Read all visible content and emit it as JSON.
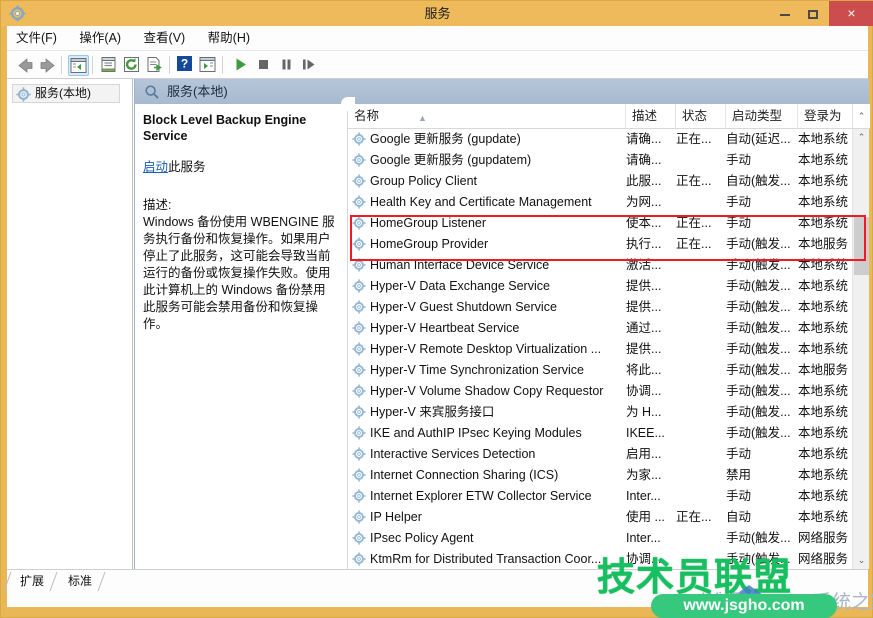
{
  "window": {
    "title": "服务",
    "app_icon": "services-gear-icon",
    "minimize_label": "最小化",
    "maximize_label": "最大化",
    "close_label": "×"
  },
  "menu": {
    "items": [
      {
        "label": "文件(F)",
        "name": "menu-file"
      },
      {
        "label": "操作(A)",
        "name": "menu-action"
      },
      {
        "label": "查看(V)",
        "name": "menu-view"
      },
      {
        "label": "帮助(H)",
        "name": "menu-help"
      }
    ]
  },
  "toolbar": {
    "buttons": [
      {
        "name": "back-icon",
        "glyph": "left-arrow"
      },
      {
        "name": "forward-icon",
        "glyph": "right-arrow"
      },
      {
        "name": "show-hide-console-tree-icon",
        "glyph": "console-tree",
        "selected": true
      },
      {
        "name": "properties-icon",
        "glyph": "properties"
      },
      {
        "name": "refresh-icon",
        "glyph": "refresh"
      },
      {
        "name": "export-list-icon",
        "glyph": "export"
      },
      {
        "name": "help-icon",
        "glyph": "help"
      },
      {
        "name": "show-action-pane-icon",
        "glyph": "action-pane"
      },
      {
        "name": "start-service-icon",
        "glyph": "play"
      },
      {
        "name": "stop-service-icon",
        "glyph": "stop"
      },
      {
        "name": "pause-service-icon",
        "glyph": "pause"
      },
      {
        "name": "restart-service-icon",
        "glyph": "restart"
      }
    ]
  },
  "tree": {
    "root_label": "服务(本地)",
    "root_icon": "services-gear-icon"
  },
  "right_pane": {
    "header_label": "服务(本地)",
    "header_icon": "services-magnifier-icon"
  },
  "details": {
    "service_name": "Block Level Backup Engine Service",
    "action_link": "启动",
    "action_suffix": "此服务",
    "description_label": "描述:",
    "description_body": "Windows 备份使用 WBENGINE 服务执行备份和恢复操作。如果用户停止了此服务，这可能会导致当前运行的备份或恢复操作失败。使用此计算机上的 Windows 备份禁用此服务可能会禁用备份和恢复操作。"
  },
  "list": {
    "columns": [
      {
        "key": "name",
        "label": "名称",
        "sorted": "asc"
      },
      {
        "key": "desc",
        "label": "描述"
      },
      {
        "key": "status",
        "label": "状态"
      },
      {
        "key": "startup",
        "label": "启动类型"
      },
      {
        "key": "logon",
        "label": "登录为"
      }
    ],
    "row_icon": "service-gear-icon",
    "rows": [
      {
        "name": "Google 更新服务 (gupdate)",
        "desc": "请确...",
        "status": "正在...",
        "startup": "自动(延迟...",
        "logon": "本地系统"
      },
      {
        "name": "Google 更新服务 (gupdatem)",
        "desc": "请确...",
        "status": "",
        "startup": "手动",
        "logon": "本地系统"
      },
      {
        "name": "Group Policy Client",
        "desc": "此服...",
        "status": "正在...",
        "startup": "自动(触发...",
        "logon": "本地系统"
      },
      {
        "name": "Health Key and Certificate Management",
        "desc": "为网...",
        "status": "",
        "startup": "手动",
        "logon": "本地系统"
      },
      {
        "name": "HomeGroup Listener",
        "desc": "使本...",
        "status": "正在...",
        "startup": "手动",
        "logon": "本地系统",
        "highlighted": true
      },
      {
        "name": "HomeGroup Provider",
        "desc": "执行...",
        "status": "正在...",
        "startup": "手动(触发...",
        "logon": "本地服务",
        "highlighted": true
      },
      {
        "name": "Human Interface Device Service",
        "desc": "激活...",
        "status": "",
        "startup": "手动(触发...",
        "logon": "本地系统"
      },
      {
        "name": "Hyper-V Data Exchange Service",
        "desc": "提供...",
        "status": "",
        "startup": "手动(触发...",
        "logon": "本地系统"
      },
      {
        "name": "Hyper-V Guest Shutdown Service",
        "desc": "提供...",
        "status": "",
        "startup": "手动(触发...",
        "logon": "本地系统"
      },
      {
        "name": "Hyper-V Heartbeat Service",
        "desc": "通过...",
        "status": "",
        "startup": "手动(触发...",
        "logon": "本地系统"
      },
      {
        "name": "Hyper-V Remote Desktop Virtualization ...",
        "desc": "提供...",
        "status": "",
        "startup": "手动(触发...",
        "logon": "本地系统"
      },
      {
        "name": "Hyper-V Time Synchronization Service",
        "desc": "将此...",
        "status": "",
        "startup": "手动(触发...",
        "logon": "本地服务"
      },
      {
        "name": "Hyper-V Volume Shadow Copy Requestor",
        "desc": "协调...",
        "status": "",
        "startup": "手动(触发...",
        "logon": "本地系统"
      },
      {
        "name": "Hyper-V 来宾服务接口",
        "desc": "为 H...",
        "status": "",
        "startup": "手动(触发...",
        "logon": "本地系统"
      },
      {
        "name": "IKE and AuthIP IPsec Keying Modules",
        "desc": "IKEE...",
        "status": "",
        "startup": "手动(触发...",
        "logon": "本地系统"
      },
      {
        "name": "Interactive Services Detection",
        "desc": "启用...",
        "status": "",
        "startup": "手动",
        "logon": "本地系统"
      },
      {
        "name": "Internet Connection Sharing (ICS)",
        "desc": "为家...",
        "status": "",
        "startup": "禁用",
        "logon": "本地系统"
      },
      {
        "name": "Internet Explorer ETW Collector Service",
        "desc": "Inter...",
        "status": "",
        "startup": "手动",
        "logon": "本地系统"
      },
      {
        "name": "IP Helper",
        "desc": "使用 ...",
        "status": "正在...",
        "startup": "自动",
        "logon": "本地系统"
      },
      {
        "name": "IPsec Policy Agent",
        "desc": "Inter...",
        "status": "",
        "startup": "手动(触发...",
        "logon": "网络服务"
      },
      {
        "name": "KtmRm for Distributed Transaction Coor...",
        "desc": "协调...",
        "status": "",
        "startup": "手动(触发...",
        "logon": "网络服务"
      }
    ],
    "scroll_up_icon": "chevron-up-icon",
    "scroll_down_icon": "chevron-down-icon"
  },
  "tabs": [
    {
      "label": "扩展",
      "name": "tab-extended",
      "active": false
    },
    {
      "label": "标准",
      "name": "tab-standard",
      "active": true
    }
  ],
  "watermark": {
    "big_text": "技术员联盟",
    "url": "www.jsgho.com",
    "win7_text": "Win7",
    "home_text": "系统之家",
    "brand_color": "#16c060",
    "pill_color": "#36c97e"
  },
  "colors": {
    "window_frame": "#eab757",
    "close_button": "#cb4d4d",
    "highlight_box": "#ee1b24",
    "link": "#1a5fb4",
    "pane_header": "#a6bace"
  }
}
